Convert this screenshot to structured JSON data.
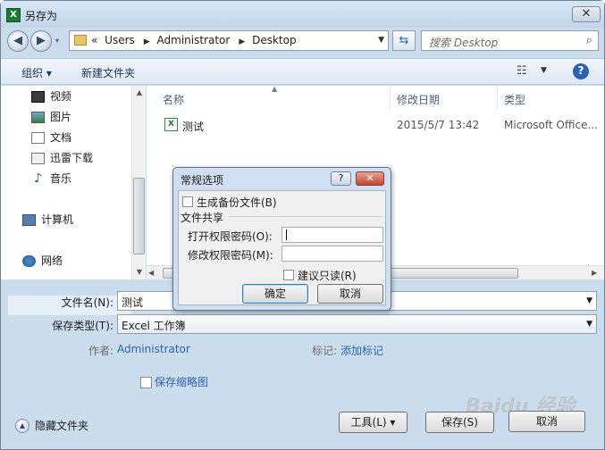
{
  "window": {
    "title": "另存为",
    "close_glyph": "✕"
  },
  "nav": {
    "recent_glyph": "▾",
    "path": [
      "«",
      "Users",
      "Administrator",
      "Desktop"
    ],
    "search_placeholder": "搜索 Desktop"
  },
  "toolbar": {
    "organize": "组织 ▾",
    "new_folder": "新建文件夹"
  },
  "sidebar": {
    "items": [
      {
        "label": "视频",
        "icon": "video-icon"
      },
      {
        "label": "图片",
        "icon": "pictures-icon"
      },
      {
        "label": "文档",
        "icon": "documents-icon"
      },
      {
        "label": "迅雷下载",
        "icon": "download-icon"
      },
      {
        "label": "音乐",
        "icon": "music-icon"
      },
      {
        "label": "计算机",
        "icon": "computer-icon"
      },
      {
        "label": "网络",
        "icon": "network-icon"
      }
    ]
  },
  "columns": {
    "name": "名称",
    "date": "修改日期",
    "type": "类型"
  },
  "files": [
    {
      "name": "测试",
      "date": "2015/5/7 13:42",
      "type": "Microsoft Office..."
    }
  ],
  "form": {
    "filename_label": "文件名(N):",
    "filename_value": "测试",
    "savetype_label": "保存类型(T):",
    "savetype_value": "Excel 工作簿",
    "author_label": "作者:",
    "author_value": "Administrator",
    "tags_label": "标记:",
    "tags_value": "添加标记",
    "thumbnail_label": "保存缩略图"
  },
  "footer": {
    "hide_folders": "隐藏文件夹",
    "tools": "工具(L)  ▾",
    "save": "保存(S)",
    "cancel": "取消"
  },
  "dialog": {
    "title": "常规选项",
    "help_glyph": "?",
    "close_glyph": "✕",
    "backup_label": "生成备份文件(B)",
    "share_header": "文件共享",
    "open_pwd_label": "打开权限密码(O):",
    "modify_pwd_label": "修改权限密码(M):",
    "readonly_label": "建议只读(R)",
    "ok": "确定",
    "cancel": "取消"
  },
  "watermark": "Baidu 经验"
}
